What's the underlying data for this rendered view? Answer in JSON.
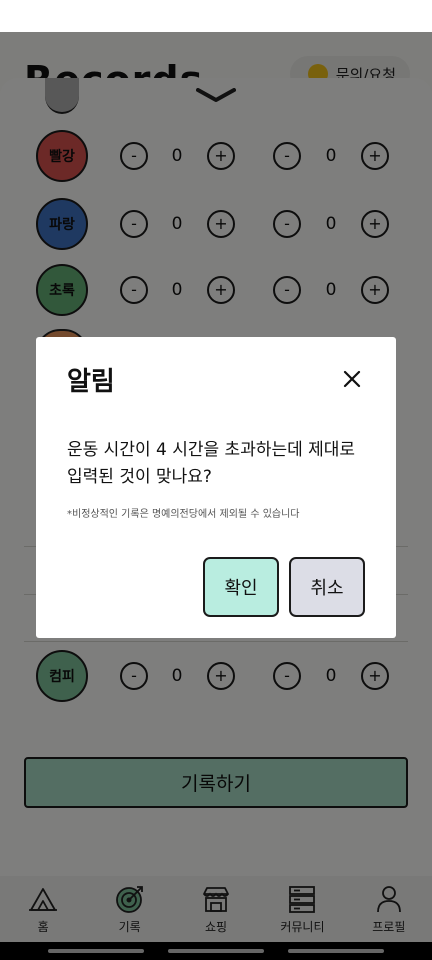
{
  "page": {
    "title": "Records",
    "inquiry_label": "문의/요청"
  },
  "rows": [
    {
      "label": "빨강",
      "color": "#d9534f",
      "left_value": "0",
      "right_value": "0"
    },
    {
      "label": "파랑",
      "color": "#3f72c2",
      "left_value": "0",
      "right_value": "0"
    },
    {
      "label": "초록",
      "color": "#64b176",
      "left_value": "0",
      "right_value": "0"
    },
    {
      "label": "컴피",
      "color": "#7fc39b",
      "left_value": "0",
      "right_value": "0"
    }
  ],
  "stepper": {
    "minus": "-",
    "plus": "+"
  },
  "record_button_label": "기록하기",
  "nav": [
    {
      "label": "홈",
      "icon": "tent-icon"
    },
    {
      "label": "기록",
      "icon": "target-icon"
    },
    {
      "label": "쇼핑",
      "icon": "store-icon"
    },
    {
      "label": "커뮤니티",
      "icon": "server-icon"
    },
    {
      "label": "프로필",
      "icon": "person-icon"
    }
  ],
  "dialog": {
    "title": "알림",
    "message": "운동 시간이 4 시간을 초과하는데 제대로 입력된 것이 맞나요?",
    "note": "*비정상적인 기록은 명예의전당에서 제외될 수 있습니다",
    "confirm_label": "확인",
    "cancel_label": "취소"
  },
  "colors": {
    "accent": "#a8dcc6",
    "confirm": "#b9ede0",
    "cancel": "#dcdde6"
  }
}
